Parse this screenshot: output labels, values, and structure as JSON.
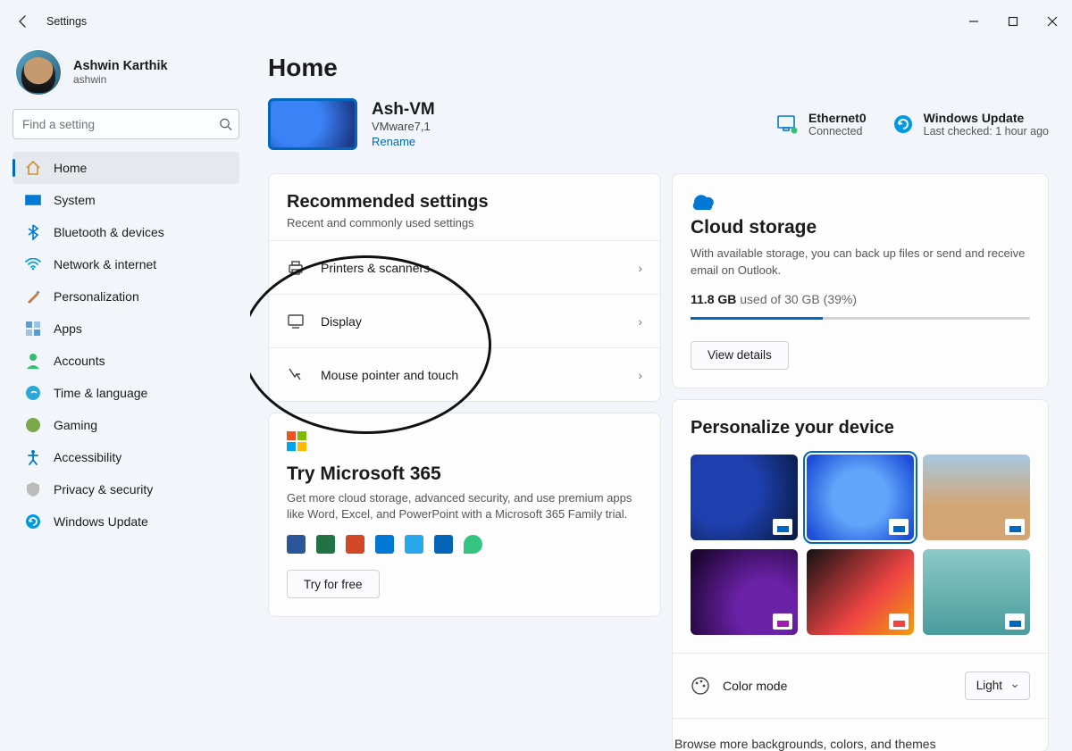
{
  "window": {
    "title": "Settings"
  },
  "profile": {
    "name": "Ashwin Karthik",
    "username": "ashwin"
  },
  "search": {
    "placeholder": "Find a setting"
  },
  "nav": {
    "items": [
      {
        "label": "Home",
        "icon": "home"
      },
      {
        "label": "System",
        "icon": "system"
      },
      {
        "label": "Bluetooth & devices",
        "icon": "bluetooth"
      },
      {
        "label": "Network & internet",
        "icon": "wifi"
      },
      {
        "label": "Personalization",
        "icon": "personalization"
      },
      {
        "label": "Apps",
        "icon": "apps"
      },
      {
        "label": "Accounts",
        "icon": "accounts"
      },
      {
        "label": "Time & language",
        "icon": "time"
      },
      {
        "label": "Gaming",
        "icon": "gaming"
      },
      {
        "label": "Accessibility",
        "icon": "accessibility"
      },
      {
        "label": "Privacy & security",
        "icon": "privacy"
      },
      {
        "label": "Windows Update",
        "icon": "update"
      }
    ]
  },
  "page_title": "Home",
  "device": {
    "name": "Ash-VM",
    "subtitle": "VMware7,1",
    "rename_label": "Rename"
  },
  "status": {
    "network": {
      "title": "Ethernet0",
      "sub": "Connected"
    },
    "update": {
      "title": "Windows Update",
      "sub": "Last checked: 1 hour ago"
    }
  },
  "recommended": {
    "title": "Recommended settings",
    "sub": "Recent and commonly used settings",
    "items": [
      {
        "label": "Printers & scanners",
        "icon": "printer"
      },
      {
        "label": "Display",
        "icon": "display"
      },
      {
        "label": "Mouse pointer and touch",
        "icon": "mouse"
      }
    ]
  },
  "m365": {
    "title": "Try Microsoft 365",
    "body": "Get more cloud storage, advanced security, and use premium apps like Word, Excel, and PowerPoint with a Microsoft 365 Family trial.",
    "button": "Try for free"
  },
  "cloud": {
    "title": "Cloud storage",
    "body": "With available storage, you can back up files or send and receive email on Outlook.",
    "used": "11.8 GB",
    "total": "used of 30 GB (39%)",
    "button": "View details",
    "percent": 39
  },
  "personalize": {
    "title": "Personalize your device",
    "color_mode_label": "Color mode",
    "color_mode_value": "Light",
    "browse": "Browse more backgrounds, colors, and themes"
  }
}
